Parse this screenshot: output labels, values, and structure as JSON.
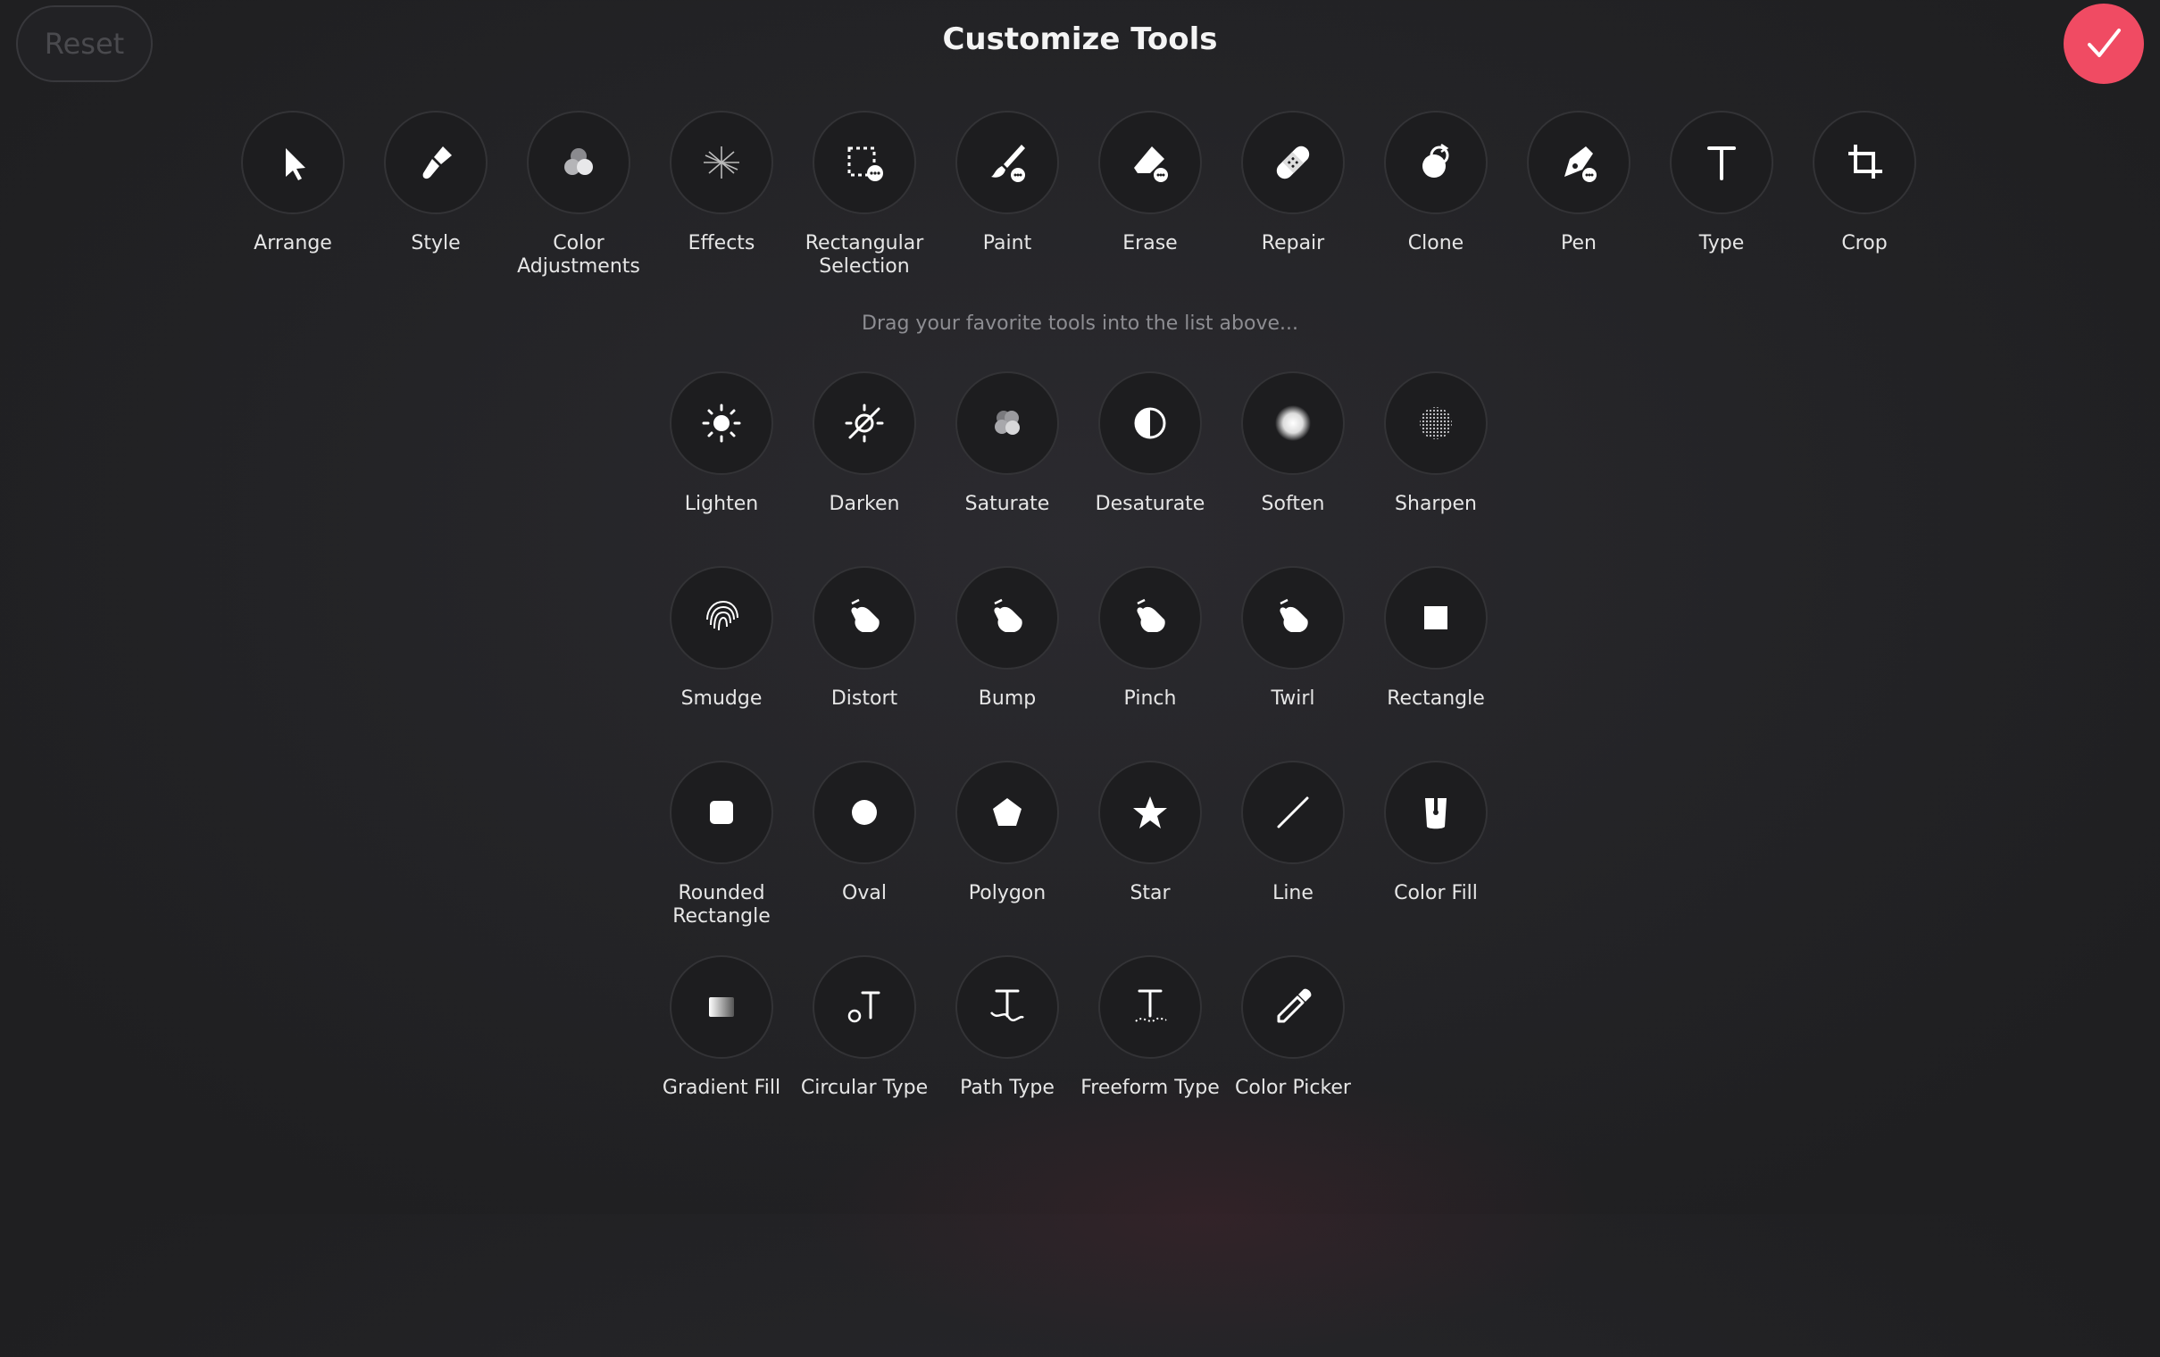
{
  "header": {
    "reset_label": "Reset",
    "title": "Customize Tools",
    "done_icon": "checkmark-icon",
    "accent_color": "#f04b63"
  },
  "hint": "Drag your favorite tools into the list above...",
  "favorites": [
    {
      "label": "Arrange",
      "icon": "arrow-cursor"
    },
    {
      "label": "Style",
      "icon": "brush"
    },
    {
      "label": "Color Adjustments",
      "icon": "color-circles"
    },
    {
      "label": "Effects",
      "icon": "sparkle"
    },
    {
      "label": "Rectangular Selection",
      "icon": "dashed-rect"
    },
    {
      "label": "Paint",
      "icon": "paintbrush"
    },
    {
      "label": "Erase",
      "icon": "eraser"
    },
    {
      "label": "Repair",
      "icon": "bandage"
    },
    {
      "label": "Clone",
      "icon": "clone"
    },
    {
      "label": "Pen",
      "icon": "pen-nib"
    },
    {
      "label": "Type",
      "icon": "type-t"
    },
    {
      "label": "Crop",
      "icon": "crop"
    }
  ],
  "available": [
    {
      "label": "Lighten",
      "icon": "sun"
    },
    {
      "label": "Darken",
      "icon": "sun-slash"
    },
    {
      "label": "Saturate",
      "icon": "color-dots"
    },
    {
      "label": "Desaturate",
      "icon": "half-circle"
    },
    {
      "label": "Soften",
      "icon": "soft-circle"
    },
    {
      "label": "Sharpen",
      "icon": "dotted-circle"
    },
    {
      "label": "Smudge",
      "icon": "fingerprint"
    },
    {
      "label": "Distort",
      "icon": "hand"
    },
    {
      "label": "Bump",
      "icon": "hand"
    },
    {
      "label": "Pinch",
      "icon": "hand"
    },
    {
      "label": "Twirl",
      "icon": "hand"
    },
    {
      "label": "Rectangle",
      "icon": "square"
    },
    {
      "label": "Rounded Rectangle",
      "icon": "rounded-square"
    },
    {
      "label": "Oval",
      "icon": "circle"
    },
    {
      "label": "Polygon",
      "icon": "pentagon"
    },
    {
      "label": "Star",
      "icon": "star"
    },
    {
      "label": "Line",
      "icon": "line"
    },
    {
      "label": "Color Fill",
      "icon": "bucket"
    },
    {
      "label": "Gradient Fill",
      "icon": "gradient-square"
    },
    {
      "label": "Circular Type",
      "icon": "circular-type"
    },
    {
      "label": "Path Type",
      "icon": "path-type"
    },
    {
      "label": "Freeform Type",
      "icon": "freeform-type"
    },
    {
      "label": "Color Picker",
      "icon": "eyedropper"
    }
  ]
}
